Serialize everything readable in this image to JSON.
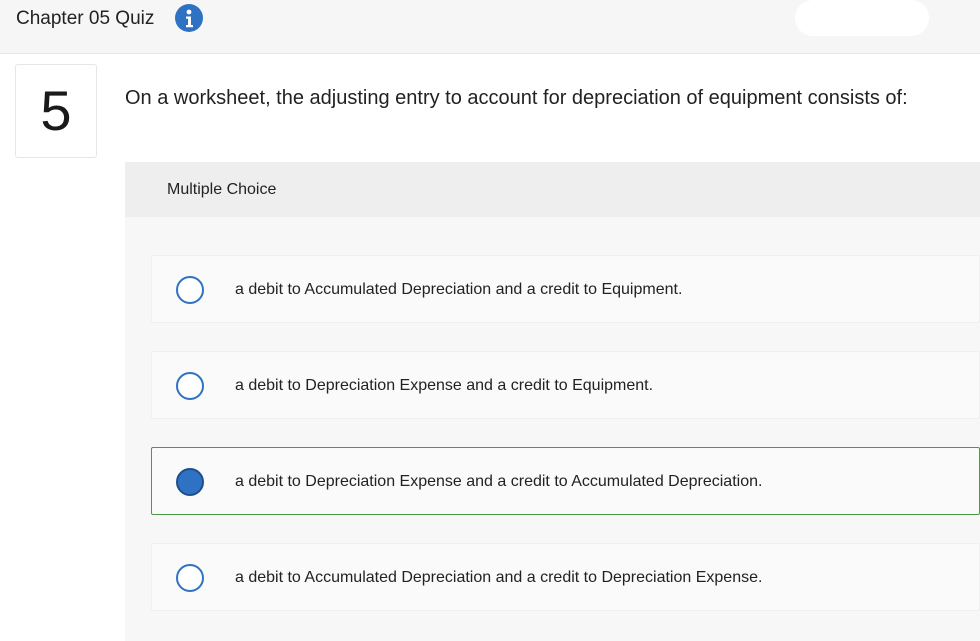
{
  "header": {
    "title": "Chapter 05 Quiz",
    "info_icon": "info-icon"
  },
  "question": {
    "number": "5",
    "text": "On a worksheet, the adjusting entry to account for depreciation of equipment consists of:"
  },
  "answer_panel": {
    "type_label": "Multiple Choice",
    "options": [
      {
        "label": "a debit to Accumulated Depreciation and a credit to Equipment.",
        "selected": false
      },
      {
        "label": "a debit to Depreciation Expense and a credit to Equipment.",
        "selected": false
      },
      {
        "label": "a debit to Depreciation Expense and a credit to Accumulated Depreciation.",
        "selected": true
      },
      {
        "label": "a debit to Accumulated Depreciation and a credit to Depreciation Expense.",
        "selected": false
      }
    ]
  },
  "colors": {
    "accent": "#2f72c4",
    "selected_border": "#4b9a44"
  }
}
